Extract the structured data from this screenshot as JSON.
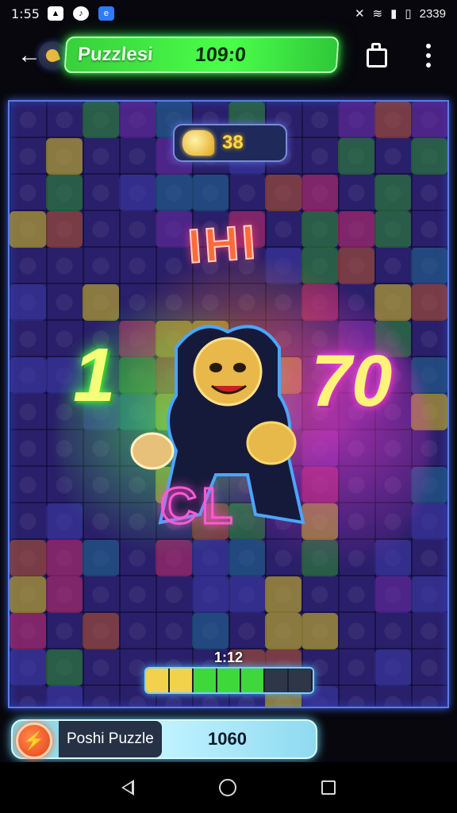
{
  "status_bar": {
    "time": "1:55",
    "right_text": "2339",
    "icons": [
      "image-icon",
      "music-icon",
      "app-icon",
      "mute-icon",
      "wifi-icon",
      "signal-icon",
      "battery-icon"
    ]
  },
  "app_bar": {
    "title": "Puzzlesi",
    "score": "109:0"
  },
  "board": {
    "coins": "38",
    "left_number": "1",
    "right_number": "70",
    "neon_top_text": "IHI",
    "neon_bottom_text": "CL",
    "progress_label": "1:12",
    "progress_value": 0.7
  },
  "level_bar": {
    "name": "Poshi Puzzle",
    "score": "1060"
  },
  "colors": {
    "accent_green": "#3cff4a",
    "accent_pink": "#ff4df2",
    "board_border": "#5b7ce6",
    "gold": "#ffd84a"
  }
}
